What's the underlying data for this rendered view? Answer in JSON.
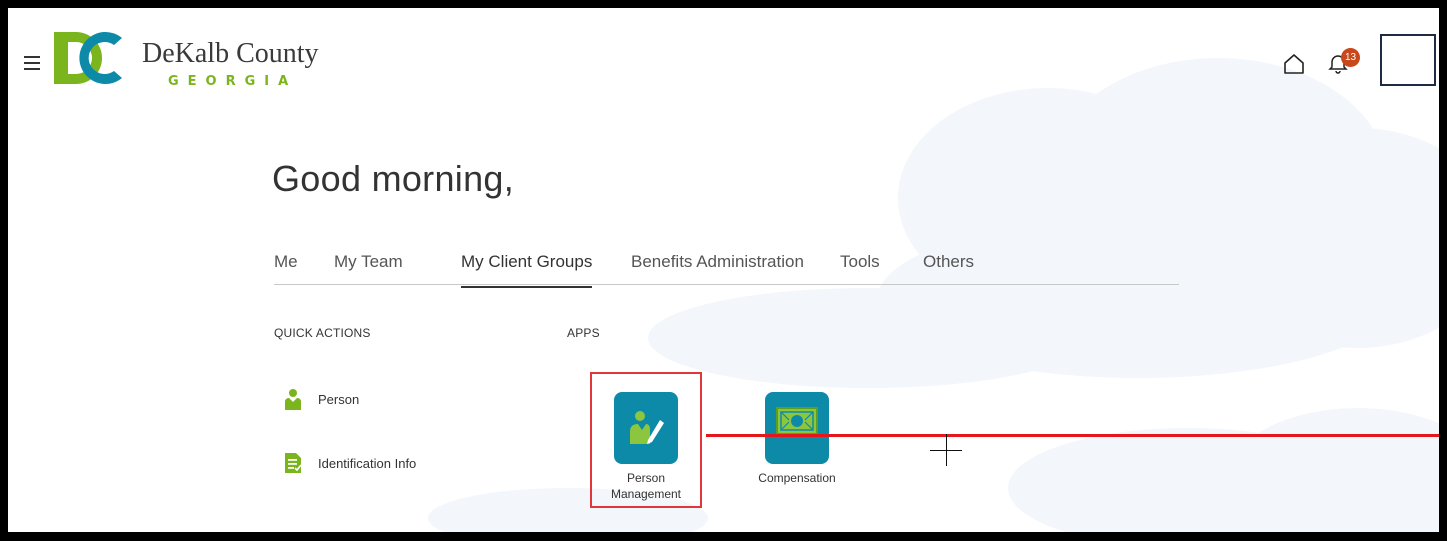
{
  "brand": {
    "name": "DeKalb County",
    "state": "GEORGIA",
    "colors": {
      "green": "#7ab51d",
      "teal": "#0e8aa9"
    }
  },
  "header": {
    "notification_count": "13",
    "icons": [
      "menu-icon",
      "home-icon",
      "bell-icon"
    ]
  },
  "greeting": "Good morning,",
  "tabs": [
    {
      "label": "Me"
    },
    {
      "label": "My Team"
    },
    {
      "label": "My Client Groups",
      "active": true
    },
    {
      "label": "Benefits Administration"
    },
    {
      "label": "Tools"
    },
    {
      "label": "Others"
    }
  ],
  "quick_actions": {
    "heading": "QUICK ACTIONS",
    "items": [
      {
        "label": "Person",
        "icon": "person-icon"
      },
      {
        "label": "Identification Info",
        "icon": "id-document-icon"
      }
    ]
  },
  "apps": {
    "heading": "APPS",
    "items": [
      {
        "label_line1": "Person",
        "label_line2": "Management",
        "icon": "person-edit-icon"
      },
      {
        "label_line1": "Compensation",
        "label_line2": "",
        "icon": "compensation-icon"
      }
    ]
  },
  "annotation": {
    "highlight_color": "#e0373b",
    "line_color": "#e6171b"
  }
}
